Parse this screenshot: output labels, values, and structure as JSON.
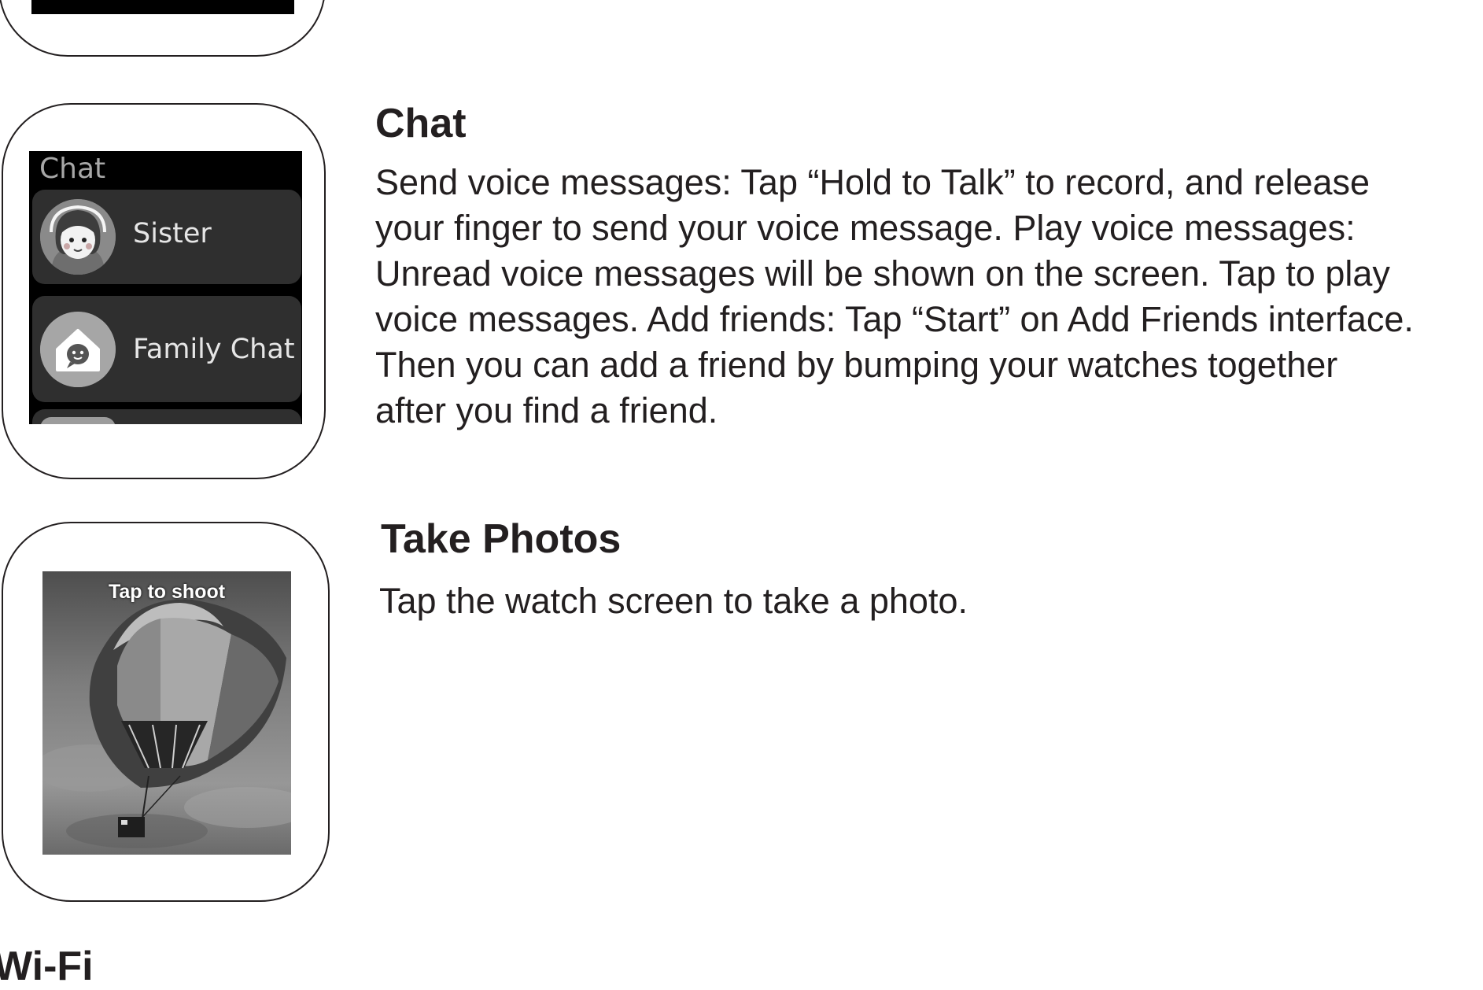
{
  "sections": {
    "chat": {
      "heading": "Chat",
      "body": "Send voice messages: Tap “Hold to Talk” to record, and release your finger to send your voice message. Play voice messages: Unread voice messages will be shown on the screen. Tap to play voice messages. Add friends: Tap “Start” on Add Friends interface. Then you can add a friend by bumping your watches together after you find a friend.",
      "body_lines": [
        "Send voice messages: Tap “Hold to Talk” to record, and release",
        "your finger to send your voice message. Play voice messages:",
        "Unread voice messages will be shown on the screen. Tap to play",
        "voice messages. Add friends: Tap “Start” on Add Friends interface.",
        "Then you can add a friend by bumping your watches together",
        "after you find a friend."
      ],
      "watch_screen": {
        "title": "Chat",
        "contacts": [
          {
            "label": "Sister",
            "icon": "girl-avatar-icon"
          },
          {
            "label": "Family Chat",
            "icon": "family-house-icon"
          }
        ]
      }
    },
    "take_photos": {
      "heading": "Take Photos",
      "body": "Tap the watch screen to take a photo.",
      "watch_screen": {
        "caption": "Tap to shoot",
        "image": "hot-air-balloon-photo"
      }
    },
    "wifi": {
      "heading": "Wi-Fi"
    }
  }
}
